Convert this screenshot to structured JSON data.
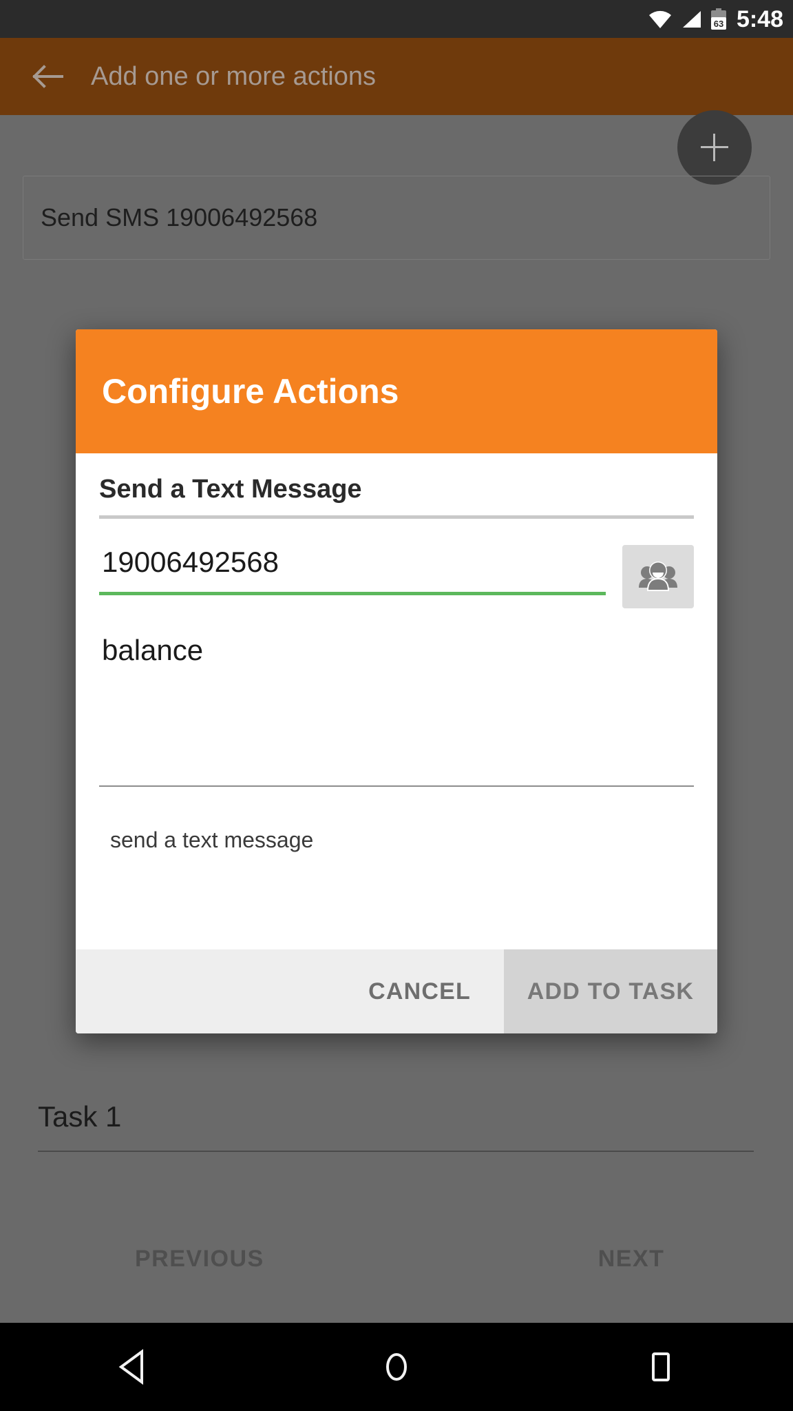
{
  "status_bar": {
    "time": "5:48",
    "battery_level": "63",
    "wifi_icon": "wifi-icon",
    "signal_icon": "cellular-signal-icon",
    "battery_icon": "battery-icon"
  },
  "app_bar": {
    "back_icon": "back-arrow-icon",
    "title": "Add one or more actions",
    "fab_icon": "plus-icon"
  },
  "background": {
    "action_card_label": "Send SMS 19006492568",
    "task_name": "Task 1",
    "previous_label": "PREVIOUS",
    "next_label": "NEXT"
  },
  "dialog": {
    "title": "Configure Actions",
    "section_title": "Send a Text Message",
    "recipient_value": "19006492568",
    "contacts_icon": "contacts-people-icon",
    "message_value": "balance",
    "hint": "send a text message",
    "cancel_label": "CANCEL",
    "confirm_label": "ADD TO TASK"
  },
  "nav_bar": {
    "back_icon": "nav-back-triangle-icon",
    "home_icon": "nav-home-circle-icon",
    "recents_icon": "nav-recents-square-icon"
  },
  "colors": {
    "accent_orange": "#F58220",
    "appbar_dimmed": "#6F3A0C",
    "scrim": "#6A6A6A",
    "focus_green": "#5CB85C",
    "status_bar": "#2B2B2B"
  }
}
